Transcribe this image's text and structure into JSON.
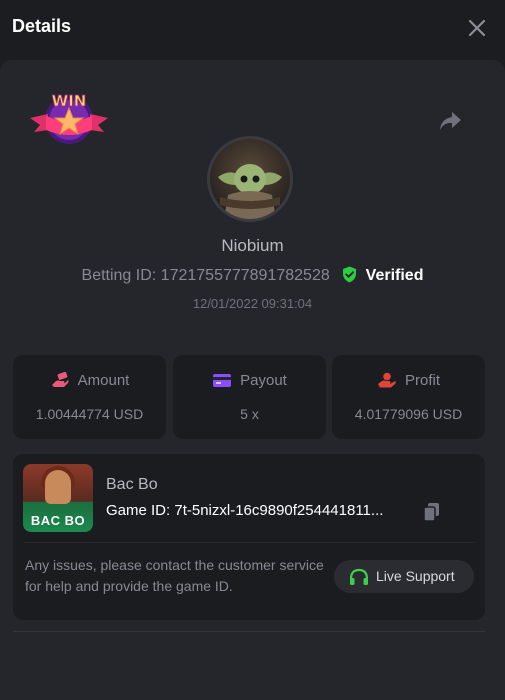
{
  "header": {
    "title": "Details"
  },
  "badge": {
    "text": "WIN"
  },
  "user": {
    "name": "Niobium",
    "betting_id_label": "Betting ID:",
    "betting_id": "1721755777891782528",
    "verified_label": "Verified",
    "datetime": "12/01/2022 09:31:04"
  },
  "stats": {
    "amount": {
      "label": "Amount",
      "value": "1.00444774 USD"
    },
    "payout": {
      "label": "Payout",
      "value": "5 x"
    },
    "profit": {
      "label": "Profit",
      "value": "4.01779096 USD"
    }
  },
  "game": {
    "thumb_text": "BAC BO",
    "name": "Bac Bo",
    "id_label": "Game ID:",
    "id_value": "7t-5nizxl-16c9890f254441811...",
    "help_text": "Any issues, please contact the customer service for help and provide the game ID.",
    "support_label": "Live Support"
  },
  "colors": {
    "background": "#1c1d21",
    "panel": "#25262b",
    "card": "#1b1c20",
    "verified_green": "#2ecc40",
    "support_green": "#3ccf4e",
    "amount_icon": "#e85a7a",
    "payout_icon": "#8a4dff",
    "profit_icon": "#e0453a"
  }
}
